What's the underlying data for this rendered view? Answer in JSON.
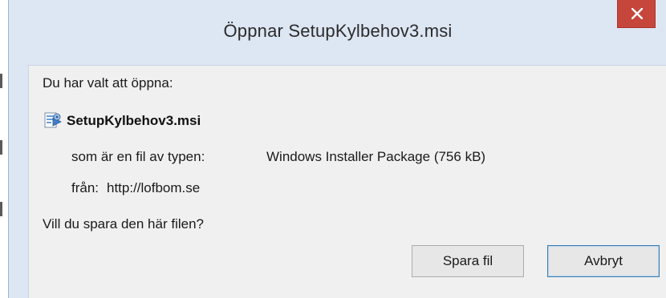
{
  "dialog": {
    "title": "Öppnar SetupKylbehov3.msi",
    "intro": "Du har valt att öppna:",
    "file": {
      "name": "SetupKylbehov3.msi",
      "icon": "msi-installer-icon",
      "type_label": "som är en fil av typen:",
      "type_value": "Windows Installer Package (756 kB)",
      "source_label": "från:",
      "source_value": "http://lofbom.se"
    },
    "question": "Vill du spara den här filen?",
    "buttons": {
      "save": "Spara fil",
      "cancel": "Avbryt"
    },
    "close_icon": "close-icon"
  },
  "colors": {
    "titlebar_bg": "#dde6f3",
    "content_bg": "#f0f0f0",
    "close_bg": "#c7463b",
    "default_button_border": "#3c7fb1"
  }
}
